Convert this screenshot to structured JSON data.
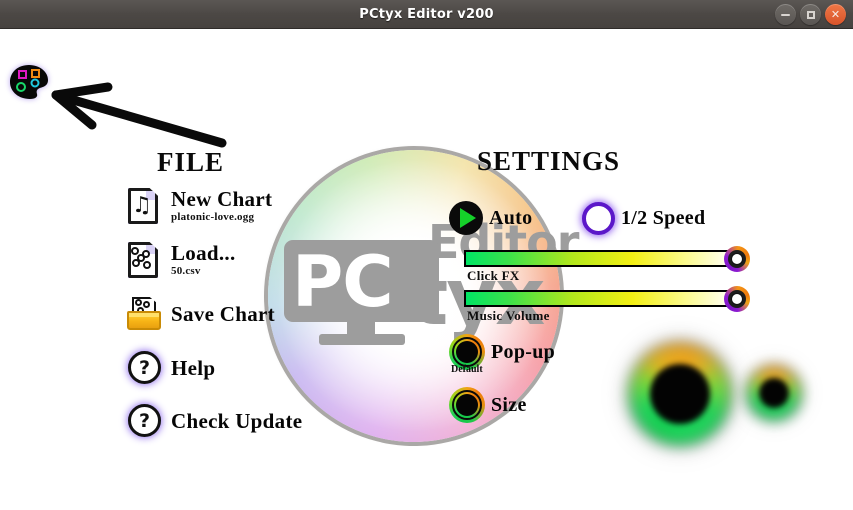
{
  "window": {
    "title": "PCtyx Editor v200",
    "controls": {
      "minimize": "minimize-button",
      "maximize": "maximize-button",
      "close": "close-button"
    }
  },
  "logo": {
    "name": "palette-icon",
    "arrow": "arrow-pointer"
  },
  "file": {
    "heading": "FILE",
    "items": [
      {
        "label": "New Chart",
        "sub": "platonic-love.ogg",
        "icon": "music-document-icon"
      },
      {
        "label": "Load...",
        "sub": "50.csv",
        "icon": "chart-document-icon"
      },
      {
        "label": "Save Chart",
        "sub": "",
        "icon": "save-folder-icon"
      },
      {
        "label": "Help",
        "sub": "",
        "icon": "question-mark-icon"
      },
      {
        "label": "Check Update",
        "sub": "",
        "icon": "question-mark-icon"
      }
    ]
  },
  "settings": {
    "heading": "SETTINGS",
    "toggles": [
      {
        "label": "Auto",
        "sub": "",
        "state": "on",
        "icon": "play-icon"
      },
      {
        "label": "1/2 Speed",
        "sub": "",
        "state": "off",
        "icon": "empty-ring-icon"
      },
      {
        "label": "Pop-up",
        "sub": "Default",
        "state": "on",
        "icon": "ring-icon"
      },
      {
        "label": "Size",
        "sub": "",
        "state": "on",
        "icon": "ring-icon"
      }
    ],
    "sliders": [
      {
        "label": "Click FX",
        "value": 100
      },
      {
        "label": "Music Volume",
        "value": 100
      }
    ]
  },
  "preview": {
    "big_orb": "note-preview-large",
    "small_orb": "note-preview-small"
  },
  "watermark": {
    "pc": "PC",
    "editor": "Editor",
    "tyx": "tyx"
  },
  "colors": {
    "titlebar": "#4c4845",
    "close_button": "#e05528",
    "accent_purple": "#5b17c9",
    "accent_orange": "#ef7a0c",
    "accent_green": "#15d02a",
    "folder_yellow": "#f7b416",
    "watermark_gray": "#9d9d9d"
  }
}
